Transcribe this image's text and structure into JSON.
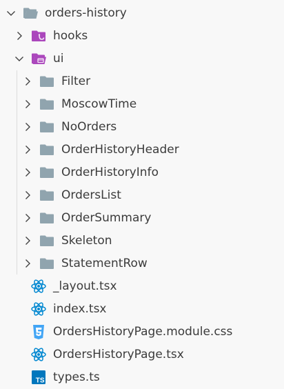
{
  "explorer": {
    "root": {
      "label": "orders-history",
      "expanded": true,
      "icon": "folder-open-icon"
    },
    "hooks": {
      "label": "hooks",
      "expanded": false,
      "icon": "folder-hooks-icon"
    },
    "ui": {
      "label": "ui",
      "expanded": true,
      "icon": "folder-ui-open-icon"
    },
    "ui_folders": [
      {
        "label": "Filter",
        "icon": "folder-icon"
      },
      {
        "label": "MoscowTime",
        "icon": "folder-icon"
      },
      {
        "label": "NoOrders",
        "icon": "folder-icon"
      },
      {
        "label": "OrderHistoryHeader",
        "icon": "folder-icon"
      },
      {
        "label": "OrderHistoryInfo",
        "icon": "folder-icon"
      },
      {
        "label": "OrdersList",
        "icon": "folder-icon"
      },
      {
        "label": "OrderSummary",
        "icon": "folder-icon"
      },
      {
        "label": "Skeleton",
        "icon": "folder-icon"
      },
      {
        "label": "StatementRow",
        "icon": "folder-icon"
      }
    ],
    "files": [
      {
        "label": "_layout.tsx",
        "icon": "react-icon"
      },
      {
        "label": "index.tsx",
        "icon": "react-icon"
      },
      {
        "label": "OrdersHistoryPage.module.css",
        "icon": "css-icon"
      },
      {
        "label": "OrdersHistoryPage.tsx",
        "icon": "react-icon"
      },
      {
        "label": "types.ts",
        "icon": "typescript-icon"
      }
    ]
  },
  "colors": {
    "text": "#3b3b3b",
    "chevron": "#424242",
    "folder": "#90a4ae",
    "special_folder": "#ab47bc",
    "react": "#0288d1",
    "css": "#42a5f5",
    "typescript": "#0277bd"
  }
}
